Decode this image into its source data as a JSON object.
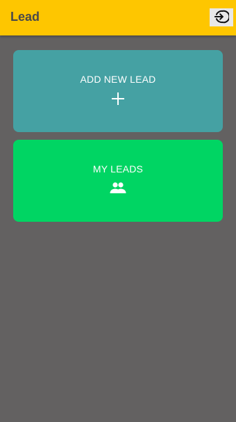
{
  "appbar": {
    "title": "Lead",
    "background": "#fec600",
    "logout_icon": "logout-icon"
  },
  "background": "#636161",
  "cards": [
    {
      "label": "ADD NEW LEAD",
      "icon": "plus-icon",
      "color": "#45a1a3"
    },
    {
      "label": "MY LEADS",
      "icon": "people-icon",
      "color": "#00d563"
    }
  ]
}
